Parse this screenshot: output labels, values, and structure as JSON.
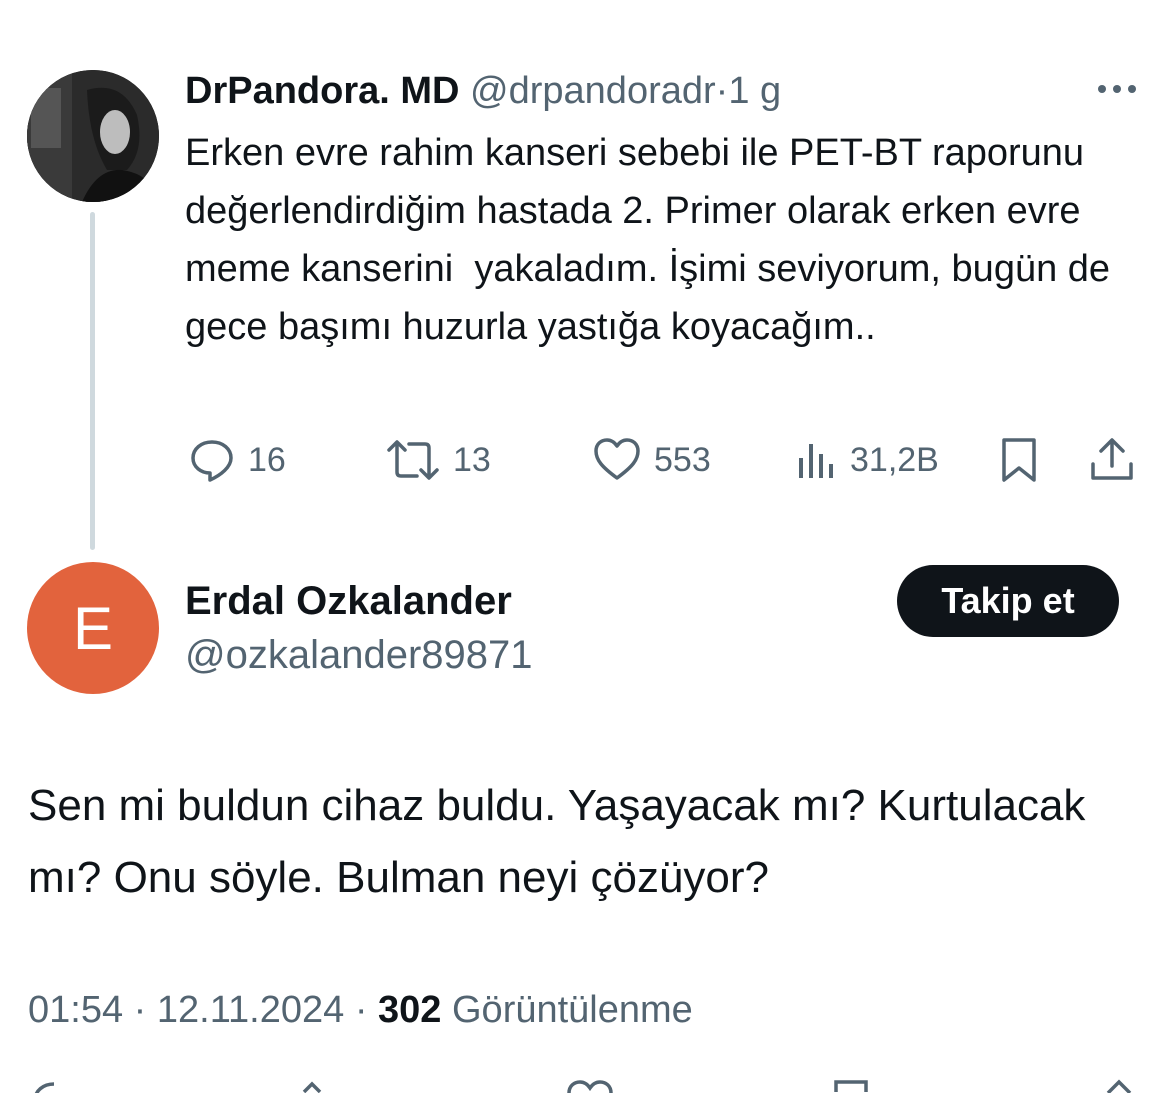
{
  "parent_tweet": {
    "display_name": "DrPandora. MD",
    "handle": "@drpandoradr",
    "separator": "·",
    "time_ago": "1 g",
    "text": "Erken evre rahim kanseri sebebi ile PET-BT raporunu değerlendirdiğim hastada 2. Primer olarak erken evre meme kanserini  yakaladım. İşimi seviyorum, bugün de gece başımı huzurla yastığa koyacağım..",
    "actions": {
      "replies": "16",
      "reposts": "13",
      "likes": "553",
      "views": "31,2B"
    },
    "icons": [
      "more-icon",
      "reply-icon",
      "repost-icon",
      "like-icon",
      "views-icon",
      "bookmark-icon",
      "share-icon"
    ]
  },
  "reply_tweet": {
    "avatar_letter": "E",
    "avatar_color": "#e2633d",
    "display_name": "Erdal Ozkalander",
    "handle": "@ozkalander89871",
    "follow_label": "Takip et",
    "text": "Sen mi buldun cihaz buldu. Yaşayacak mı? Kurtulacak mı? Onu söyle. Bulman neyi çözüyor?",
    "time": "01:54",
    "date": "12.11.2024",
    "separator": "·",
    "view_count": "302",
    "view_label": "Görüntülenme"
  },
  "colors": {
    "text_primary": "#0f1419",
    "text_secondary": "#536471",
    "thread_line": "#cfd9de",
    "button_dark": "#0f1419"
  }
}
